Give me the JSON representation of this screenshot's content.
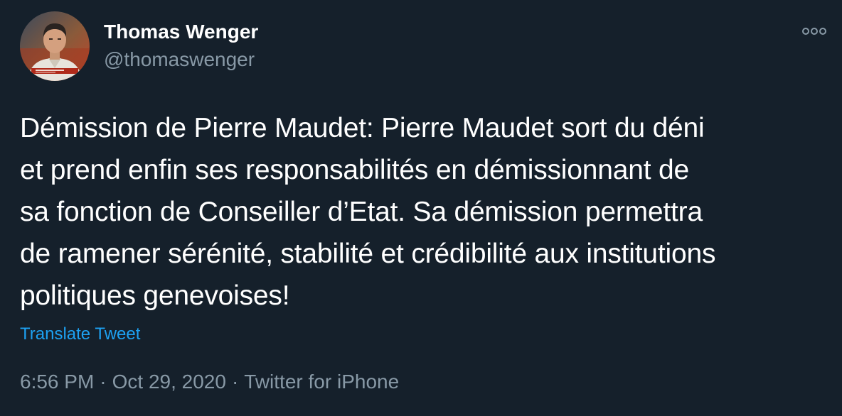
{
  "theme": {
    "background": "#15202b",
    "text": "#ffffff",
    "secondary": "#8899a6",
    "accent": "#1da1f2"
  },
  "author": {
    "name": "Thomas Wenger",
    "handle": "@thomaswenger",
    "avatar_icon": "profile-photo"
  },
  "menu": {
    "icon": "more-horizontal-icon"
  },
  "tweet": {
    "text": "Démission de Pierre Maudet: Pierre Maudet sort du déni\net prend enfin ses responsabilités en démissionnant de\nsa fonction de Conseiller d’Etat. Sa démission permettra\nde ramener sérénité, stabilité et crédibilité aux institutions\npolitiques genevoises!",
    "translate_label": "Translate Tweet"
  },
  "meta": {
    "time": "6:56 PM",
    "separator": "·",
    "date": "Oct 29, 2020",
    "source": "Twitter for iPhone"
  }
}
